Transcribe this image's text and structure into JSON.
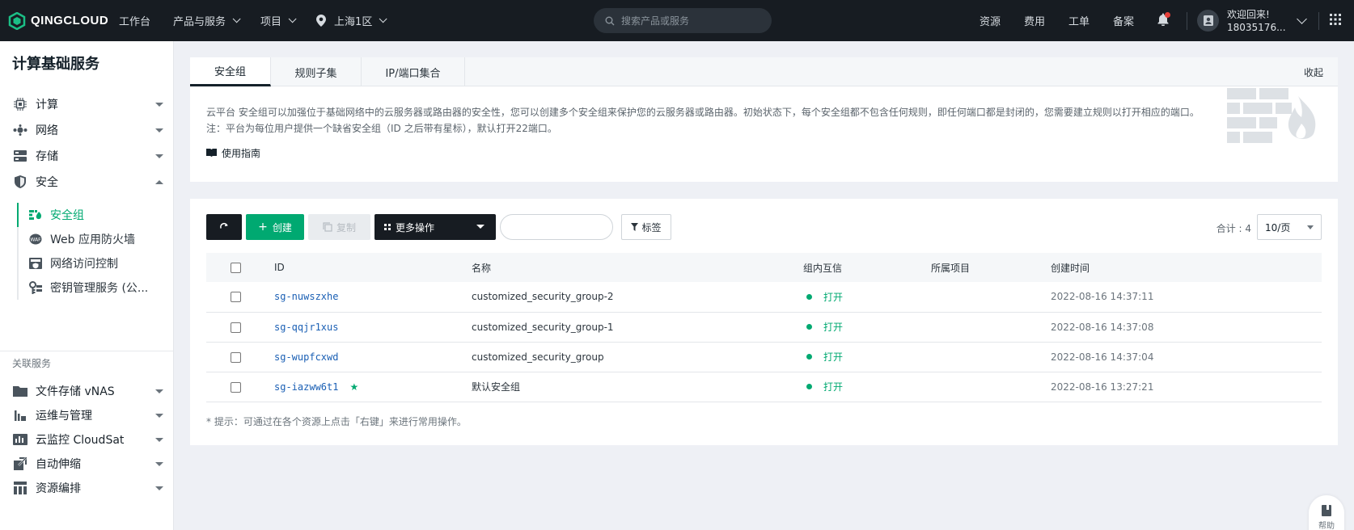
{
  "topbar": {
    "logo": "QINGCLOUD",
    "nav": [
      {
        "label": "工作台",
        "has_caret": false
      },
      {
        "label": "产品与服务",
        "has_caret": true
      },
      {
        "label": "项目",
        "has_caret": true
      }
    ],
    "region": "上海1区",
    "search_placeholder": "搜索产品或服务",
    "right_items": [
      "资源",
      "费用",
      "工单",
      "备案"
    ],
    "welcome_line1": "欢迎回来!",
    "welcome_line2": "18035176..."
  },
  "sidebar": {
    "title": "计算基础服务",
    "items": [
      {
        "label": "计算",
        "icon": "chip-icon"
      },
      {
        "label": "网络",
        "icon": "network-icon"
      },
      {
        "label": "存储",
        "icon": "storage-icon"
      },
      {
        "label": "安全",
        "icon": "shield-icon"
      }
    ],
    "security_sub": [
      {
        "label": "安全组",
        "icon": "security-group-icon",
        "active": true
      },
      {
        "label": "Web 应用防火墙",
        "icon": "waf-icon",
        "active": false
      },
      {
        "label": "网络访问控制",
        "icon": "access-control-icon",
        "active": false
      },
      {
        "label": "密钥管理服务 (公...",
        "icon": "key-icon",
        "active": false
      }
    ],
    "assoc_label": "关联服务",
    "assoc_items": [
      {
        "label": "文件存储 vNAS",
        "icon": "folder-icon"
      },
      {
        "label": "运维与管理",
        "icon": "ops-icon"
      },
      {
        "label": "云监控 CloudSat",
        "icon": "monitor-icon"
      },
      {
        "label": "自动伸缩",
        "icon": "autoscale-icon"
      },
      {
        "label": "资源编排",
        "icon": "orchestration-icon"
      }
    ]
  },
  "tabs": [
    "安全组",
    "规则子集",
    "IP/端口集合"
  ],
  "collapse_label": "收起",
  "description": "云平台 安全组可以加强位于基础网络中的云服务器或路由器的安全性，您可以创建多个安全组来保护您的云服务器或路由器。初始状态下，每个安全组都不包含任何规则，即任何端口都是封闭的，您需要建立规则以打开相应的端口。注：平台为每位用户提供一个缺省安全组（ID 之后带有星标），默认打开22端口。",
  "guide_label": "使用指南",
  "toolbar": {
    "create": "创建",
    "copy": "复制",
    "more": "更多操作",
    "tag": "标签",
    "total": "合计 : 4",
    "page_size": "10/页"
  },
  "table": {
    "headers": [
      "ID",
      "名称",
      "组内互信",
      "所属项目",
      "创建时间"
    ],
    "rows": [
      {
        "id": "sg-nuwszxhe",
        "name": "customized_security_group-2",
        "trust": "打开",
        "project": "",
        "created": "2022-08-16 14:37:11",
        "default": false
      },
      {
        "id": "sg-qqjr1xus",
        "name": "customized_security_group-1",
        "trust": "打开",
        "project": "",
        "created": "2022-08-16 14:37:08",
        "default": false
      },
      {
        "id": "sg-wupfcxwd",
        "name": "customized_security_group",
        "trust": "打开",
        "project": "",
        "created": "2022-08-16 14:37:04",
        "default": false
      },
      {
        "id": "sg-iazww6t1",
        "name": "默认安全组",
        "trust": "打开",
        "project": "",
        "created": "2022-08-16 13:27:21",
        "default": true
      }
    ]
  },
  "hint": "* 提示：可通过在各个资源上点击「右键」来进行常用操作。",
  "help_label": "帮助",
  "colors": {
    "accent": "#00a971",
    "topbar": "#171c22",
    "link": "#1a5fb4"
  }
}
